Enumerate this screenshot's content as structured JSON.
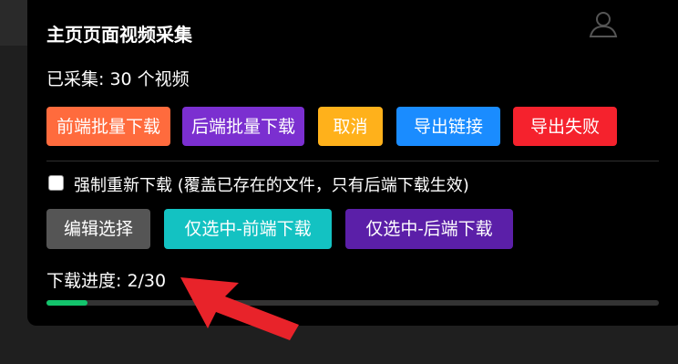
{
  "panel": {
    "title": "主页页面视频采集",
    "count_text": "已采集: 30 个视频",
    "buttons_row1": [
      {
        "label": "前端批量下载",
        "color": "#ff6b3d"
      },
      {
        "label": "后端批量下载",
        "color": "#7b2fd0"
      },
      {
        "label": "取消",
        "color": "#ffb11b"
      },
      {
        "label": "导出链接",
        "color": "#1a8cff"
      },
      {
        "label": "导出失败",
        "color": "#f5222d"
      }
    ],
    "force_redownload": {
      "checked": false,
      "label": "强制重新下载 (覆盖已存在的文件，只有后端下载生效)"
    },
    "buttons_row2": [
      {
        "label": "编辑选择",
        "color": "#555555"
      },
      {
        "label": "仅选中-前端下载",
        "color": "#13c2c2"
      },
      {
        "label": "仅选中-后端下载",
        "color": "#5b1fa8"
      }
    ],
    "progress": {
      "label": "下载进度: 2/30",
      "value": 0.0667,
      "color": "#13c46c"
    }
  },
  "icons": {
    "user": "user-icon",
    "annotation": "red-arrow-icon"
  }
}
